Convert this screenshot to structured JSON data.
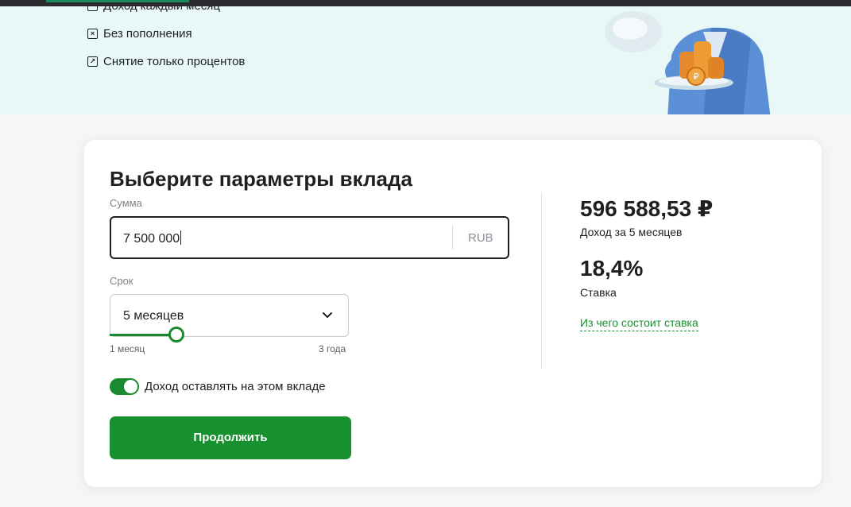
{
  "features": [
    {
      "label": "Доход каждый месяц",
      "icon": "checkbox-icon"
    },
    {
      "label": "Без пополнения",
      "icon": "close-box-icon"
    },
    {
      "label": "Снятие только процентов",
      "icon": "arrow-out-box-icon"
    }
  ],
  "form": {
    "title": "Выберите параметры вклада",
    "amount_label": "Сумма",
    "amount_value": "7 500 000",
    "currency": "RUB",
    "term_label": "Срок",
    "term_value": "5 месяцев",
    "term_min_label": "1 месяц",
    "term_max_label": "3 года",
    "term_progress_fraction": 0.28,
    "reinvest_label": "Доход оставлять на этом вкладе",
    "reinvest_enabled": true,
    "submit_label": "Продолжить"
  },
  "result": {
    "income": "596 588,53 ₽",
    "income_caption": "Доход за 5 месяцев",
    "rate": "18,4%",
    "rate_caption": "Ставка",
    "rate_link": "Из чего состоит ставка"
  },
  "colors": {
    "accent": "#17902f",
    "hero_bg": "#e7f8f7"
  }
}
